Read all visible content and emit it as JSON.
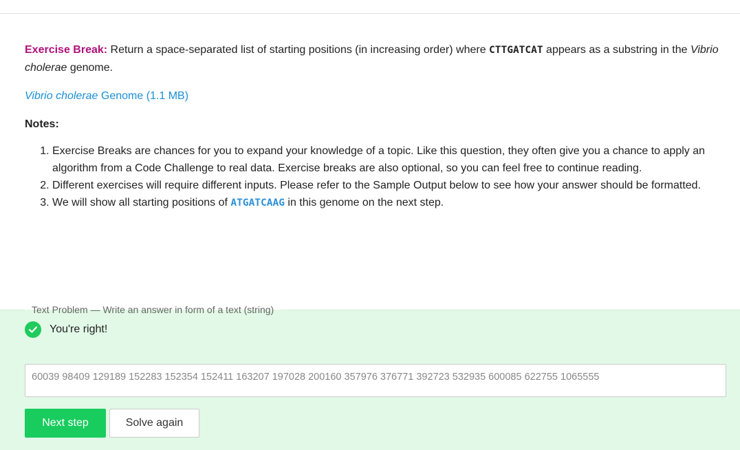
{
  "exercise": {
    "label": "Exercise Break:",
    "text_before": " Return a space-separated list of starting positions (in increasing order) where ",
    "pattern": "CTTGATCAT",
    "text_mid": " appears as a substring in the ",
    "organism": "Vibrio cholerae",
    "text_after": " genome."
  },
  "genome_link": {
    "organism": "Vibrio cholerae",
    "label": " Genome (1.1 MB)"
  },
  "notes": {
    "heading": "Notes:",
    "items": [
      "Exercise Breaks are chances for you to expand your knowledge of a topic. Like this question, they often give you a chance to apply an algorithm from a Code Challenge to real data. Exercise breaks are also optional, so you can feel free to continue reading.",
      "Different exercises will require different inputs. Please refer to the Sample Output below to see how your answer should be formatted."
    ],
    "item3_before": "We will show all starting positions of ",
    "item3_code": "ATGATCAAG",
    "item3_after": " in this genome on the next step."
  },
  "problem": {
    "legend": "Text Problem — Write an answer in form of a text (string)",
    "status": "You're right!",
    "answer": "60039 98409 129189 152283 152354 152411 163207 197028 200160 357976 376771 392723 532935 600085 622755 1065555",
    "next_label": "Next step",
    "solve_again_label": "Solve again"
  },
  "colors": {
    "exercise_label": "#b0117a",
    "link": "#1a8fd6",
    "panel_bg": "#e1f9e6",
    "success": "#19cc5e"
  },
  "icons": {
    "status": "check-circle-icon"
  }
}
